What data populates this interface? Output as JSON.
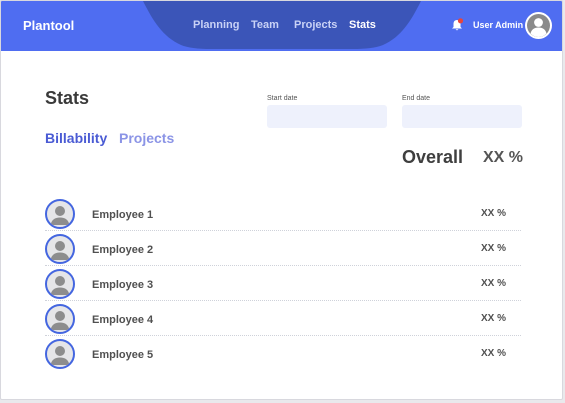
{
  "header": {
    "logo": "Plantool",
    "nav": [
      {
        "label": "Planning"
      },
      {
        "label": "Team"
      },
      {
        "label": "Projects"
      },
      {
        "label": "Stats",
        "active": true
      }
    ],
    "notification_icon": "bell-icon",
    "user_name": "User Admin",
    "avatar_icon": "user-avatar-icon",
    "accent_color": "#4f6df1",
    "nav_tab_color": "#3b55b8",
    "notification_dot_color": "#e8453c"
  },
  "main": {
    "title": "Stats",
    "tabs": [
      {
        "label": "Billability",
        "active": true
      },
      {
        "label": "Projects",
        "active": false
      }
    ],
    "start_date": {
      "label": "Start date",
      "value": ""
    },
    "end_date": {
      "label": "End date",
      "value": ""
    },
    "overall": {
      "label": "Overall",
      "value": "XX %"
    },
    "employees": [
      {
        "name": "Employee 1",
        "value": "XX %"
      },
      {
        "name": "Employee 2",
        "value": "XX %"
      },
      {
        "name": "Employee 3",
        "value": "XX %"
      },
      {
        "name": "Employee 4",
        "value": "XX %"
      },
      {
        "name": "Employee 5",
        "value": "XX %"
      }
    ]
  }
}
